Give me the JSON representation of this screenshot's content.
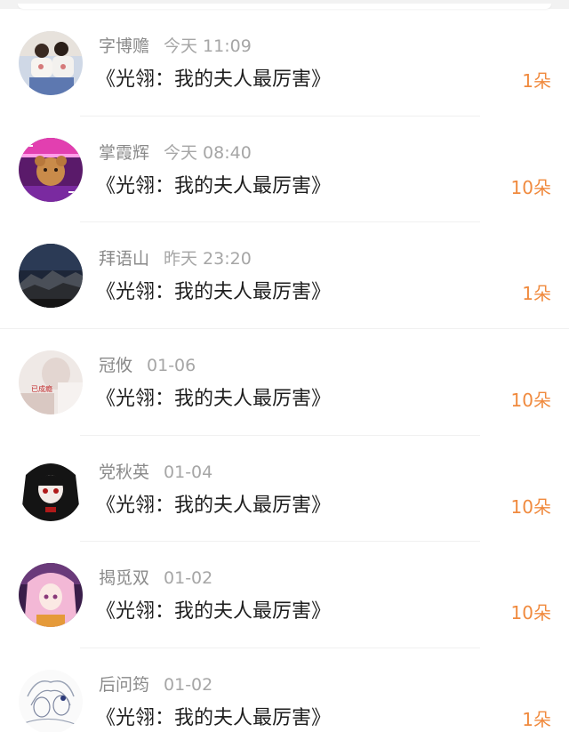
{
  "comments": [
    {
      "name": "字博赡",
      "time": "今天 11:09",
      "title": "《光翎：我的夫人最厉害》",
      "flowers": "1朵",
      "avatar": "couple-photo"
    },
    {
      "name": "掌霞辉",
      "time": "今天 08:40",
      "title": "《光翎：我的夫人最厉害》",
      "flowers": "10朵",
      "avatar": "neon-bear"
    },
    {
      "name": "拜语山",
      "time": "昨天 23:20",
      "title": "《光翎：我的夫人最厉害》",
      "flowers": "1朵",
      "avatar": "night-mountain"
    },
    {
      "name": "冠攸",
      "time": "01-06",
      "title": "《光翎：我的夫人最厉害》",
      "flowers": "10朵",
      "avatar": "pale-girl",
      "avatar_text": "已成瘾"
    },
    {
      "name": "党秋英",
      "time": "01-04",
      "title": "《光翎：我的夫人最厉害》",
      "flowers": "10朵",
      "avatar": "gothic-anime"
    },
    {
      "name": "揭觅双",
      "time": "01-02",
      "title": "《光翎：我的夫人最厉害》",
      "flowers": "10朵",
      "avatar": "pink-anime"
    },
    {
      "name": "后问筠",
      "time": "01-02",
      "title": "《光翎：我的夫人最厉害》",
      "flowers": "1朵",
      "avatar": "sketch-anime"
    }
  ],
  "colors": {
    "accent": "#f08a3e",
    "title": "#1e1e1e",
    "meta": "#9a9a9a",
    "divider": "#f0f0f0"
  }
}
